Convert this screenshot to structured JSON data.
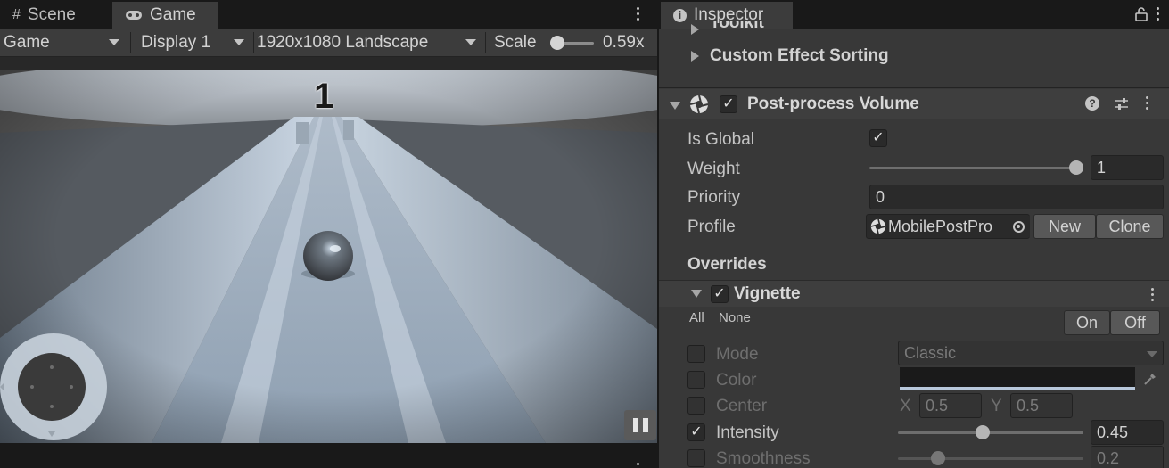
{
  "left_panel": {
    "tabs": [
      {
        "label": "Scene",
        "icon": "grid-icon"
      },
      {
        "label": "Game",
        "icon": "gamepad-icon"
      }
    ],
    "toolbar": {
      "view_select": "Game",
      "display_select": "Display 1",
      "resolution_select": "1920x1080 Landscape",
      "scale_label": "Scale",
      "scale_value": "0.59x",
      "scale_level": 0.05
    },
    "viewport": {
      "score": "1"
    }
  },
  "inspector": {
    "tab_label": "Inspector",
    "tab_icon": "info-icon",
    "collapsed_sections": [
      "Toolkit",
      "Custom Effect Sorting"
    ],
    "component": {
      "title": "Post-process Volume",
      "enabled": true,
      "fields": {
        "is_global_label": "Is Global",
        "is_global": true,
        "weight_label": "Weight",
        "weight_value": "1",
        "priority_label": "Priority",
        "priority_value": "0",
        "profile_label": "Profile",
        "profile_value": "MobilePostPro",
        "new_button": "New",
        "clone_button": "Clone"
      },
      "overrides_label": "Overrides",
      "effect": {
        "title": "Vignette",
        "enabled": true,
        "all_label": "All",
        "none_label": "None",
        "on_label": "On",
        "off_label": "Off",
        "mode_label": "Mode",
        "mode_value": "Classic",
        "color_label": "Color",
        "color_value": "#1a1a1a",
        "center_label": "Center",
        "center_x_label": "X",
        "center_x": "0.5",
        "center_y_label": "Y",
        "center_y": "0.5",
        "intensity_label": "Intensity",
        "intensity_value": "0.45",
        "smoothness_label": "Smoothness",
        "smoothness_value": "0.2"
      }
    }
  },
  "colors": {
    "panel_bg": "#383838",
    "field_bg": "#2a2a2a",
    "text": "#c4c4c4",
    "track_light": "#b8c8db",
    "viewport_dark": "#5f5f5f"
  }
}
